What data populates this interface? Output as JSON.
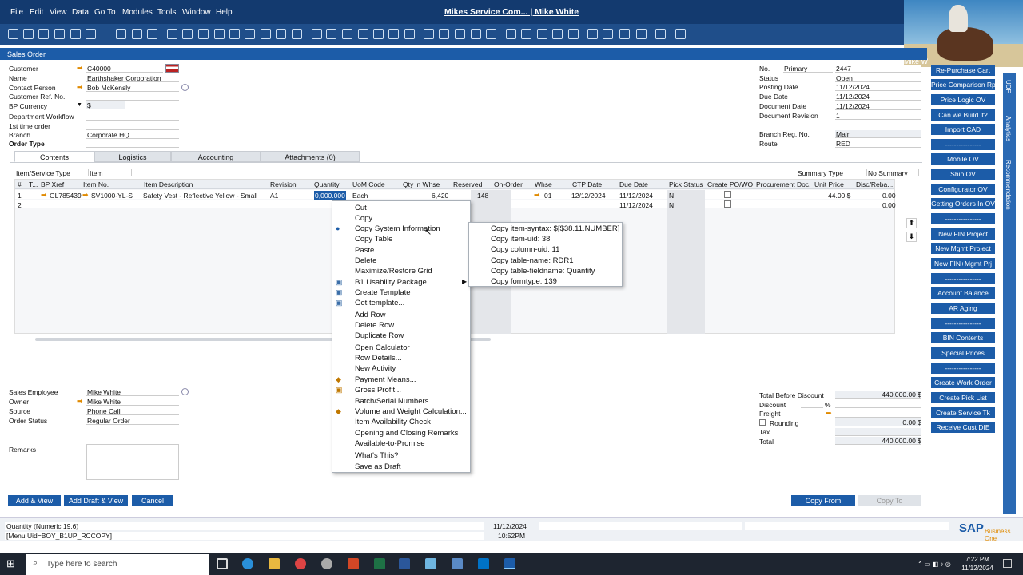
{
  "menu": [
    "File",
    "Edit",
    "View",
    "Data",
    "Go To",
    "Modules",
    "Tools",
    "Window",
    "Help"
  ],
  "app_title": "Mikes Service Com... | Mike White",
  "webcam_caption": "Mike W",
  "form_title": "Sales Order",
  "header_left": [
    {
      "label": "Customer",
      "value": "C40000"
    },
    {
      "label": "Name",
      "value": "Earthshaker Corporation"
    },
    {
      "label": "Contact Person",
      "value": "Bob McKensly"
    },
    {
      "label": "Customer Ref. No.",
      "value": ""
    },
    {
      "label": "BP Currency",
      "value": "$"
    },
    {
      "label": "Department Workflow",
      "value": ""
    },
    {
      "label": "1st time order",
      "value": ""
    },
    {
      "label": "Branch",
      "value": "Corporate HQ"
    },
    {
      "label": "Order Type",
      "value": ""
    }
  ],
  "header_right": [
    {
      "label": "No.",
      "value": "2447",
      "series": "Primary"
    },
    {
      "label": "Status",
      "value": "Open"
    },
    {
      "label": "Posting Date",
      "value": "11/12/2024"
    },
    {
      "label": "Due Date",
      "value": "11/12/2024"
    },
    {
      "label": "Document Date",
      "value": "11/12/2024"
    },
    {
      "label": "Document Revision",
      "value": "1"
    },
    {
      "label": "Branch Reg. No.",
      "value": "Main"
    },
    {
      "label": "Route",
      "value": "RED"
    }
  ],
  "tabs": [
    "Contents",
    "Logistics",
    "Accounting",
    "Attachments (0)"
  ],
  "item_type_label": "Item/Service Type",
  "item_type_value": "Item",
  "summary_label": "Summary Type",
  "summary_value": "No Summary",
  "grid_headers": [
    "#",
    "T...",
    "BP Xref",
    "Item No.",
    "Item Description",
    "Revision",
    "Quantity",
    "UoM Code",
    "Qty in Whse",
    "Reserved",
    "On-Order",
    "Whse",
    "CTP Date",
    "Due Date",
    "Pick Status",
    "Create PO/WO",
    "Procurement Doc.",
    "Unit Price",
    "Disc/Reba..."
  ],
  "row1": {
    "num": "1",
    "xref": "GL785439",
    "item": "SV1000-YL-S",
    "desc": "Safety Vest - Reflective Yellow - Small",
    "rev": "A1",
    "qty": "0,000.000",
    "uom": "Each",
    "whse_qty": "6,420",
    "reserved": "148",
    "whse": "01",
    "ctp": "12/12/2024",
    "due": "11/12/2024",
    "pick": "N",
    "price": "44.00 $",
    "disc": "0.00"
  },
  "row2": {
    "num": "2",
    "due": "11/12/2024",
    "pick": "N",
    "disc": "0.00"
  },
  "context_menu": [
    "Cut",
    "Copy",
    "Copy System Information",
    "Copy Table",
    "Paste",
    "Delete",
    "Maximize/Restore Grid",
    "B1 Usability Package",
    "Create Template",
    "Get template...",
    "Add Row",
    "Delete Row",
    "Duplicate Row",
    "Open Calculator",
    "Row Details...",
    "New Activity",
    "Payment Means...",
    "Gross Profit...",
    "Batch/Serial Numbers",
    "Volume and Weight Calculation...",
    "Item Availability Check",
    "Opening and Closing Remarks",
    "Available-to-Promise",
    "What's This?",
    "Save as Draft"
  ],
  "submenu": [
    "Copy item-syntax: $[$38.11.NUMBER]",
    "Copy item-uid: 38",
    "Copy column-uid: 11",
    "Copy table-name: RDR1",
    "Copy table-fieldname: Quantity",
    "Copy formtype: 139"
  ],
  "footer_left": [
    {
      "label": "Sales Employee",
      "value": "Mike White"
    },
    {
      "label": "Owner",
      "value": "Mike White"
    },
    {
      "label": "Source",
      "value": "Phone Call"
    },
    {
      "label": "Order Status",
      "value": "Regular Order"
    }
  ],
  "remarks_label": "Remarks",
  "totals": [
    {
      "label": "Total Before Discount",
      "value": "440,000.00 $"
    },
    {
      "label": "Discount",
      "value": "",
      "pct": "%"
    },
    {
      "label": "Freight",
      "value": ""
    },
    {
      "label": "Rounding",
      "value": "0.00 $"
    },
    {
      "label": "Tax",
      "value": ""
    },
    {
      "label": "Total",
      "value": "440,000.00 $"
    }
  ],
  "buttons": {
    "add_view": "Add & View",
    "add_draft": "Add Draft & View",
    "cancel": "Cancel",
    "copy_from": "Copy From",
    "copy_to": "Copy To"
  },
  "side_buttons": [
    "Re-Purchase Cart",
    "Price Comparison Rpt",
    "Price Logic OV",
    "Can we Build it?",
    "Import CAD",
    "----------------",
    "Mobile OV",
    "Ship OV",
    "Configurator OV",
    "Getting Orders In OV",
    "----------------",
    "New FIN Project",
    "New Mgmt Project",
    "New FIN+Mgmt Prj",
    "----------------",
    "Account Balance",
    "AR Aging",
    "----------------",
    "BIN Contents",
    "Special Prices",
    "----------------",
    "Create Work Order",
    "Create Pick List",
    "Create Service Tk",
    "Receive Cust DIE"
  ],
  "vtabs": [
    "UDF",
    "Analytics",
    "Recommendation"
  ],
  "status": {
    "line1": "Quantity (Numeric 19.6)",
    "line2": "[Menu Uid=BOY_B1UP_RCCOPY]",
    "date": "11/12/2024",
    "time": "10:52PM",
    "logo": "SAP",
    "logo_sub": "Business One"
  },
  "taskbar": {
    "search": "Type here to search",
    "time": "7:22 PM",
    "date": "11/12/2024"
  },
  "colors": {
    "brand": "#133a6f",
    "button": "#1c5ca8",
    "arrow": "#e08a00"
  }
}
